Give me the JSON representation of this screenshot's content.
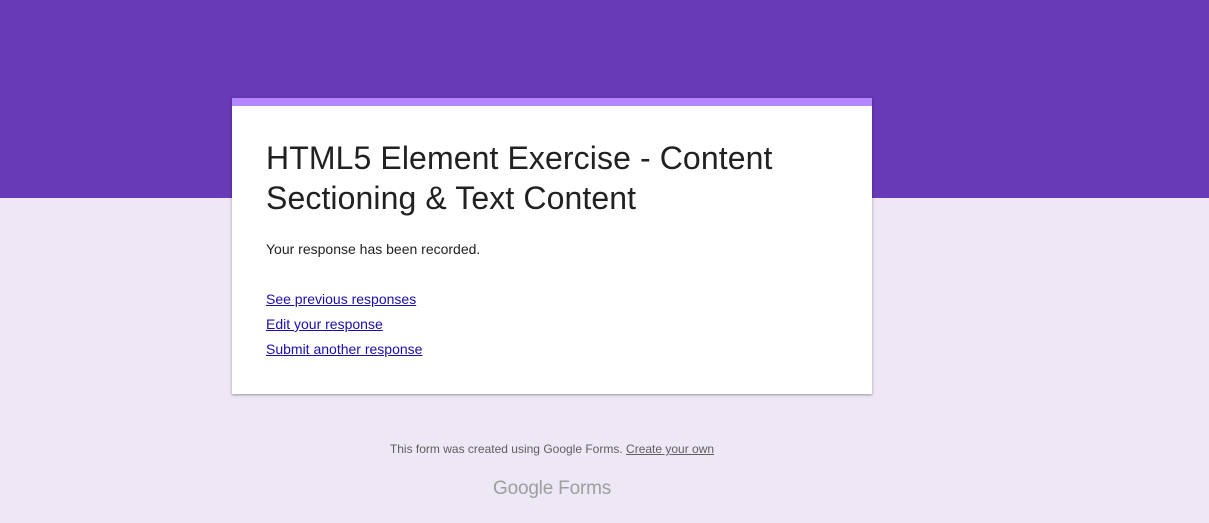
{
  "theme": {
    "header_color": "#673ab7",
    "accent_color": "#b388ff",
    "background_color": "#ede7f6",
    "link_color": "#1a0dab"
  },
  "card": {
    "title": "HTML5 Element Exercise - Content Sectioning & Text Content",
    "message": "Your response has been recorded.",
    "links": {
      "see_previous": "See previous responses",
      "edit_response": "Edit your response",
      "submit_another": "Submit another response"
    }
  },
  "footer": {
    "note": "This form was created using Google Forms.",
    "create_link": "Create your own",
    "logo_google": "Google",
    "logo_forms": "Forms"
  }
}
